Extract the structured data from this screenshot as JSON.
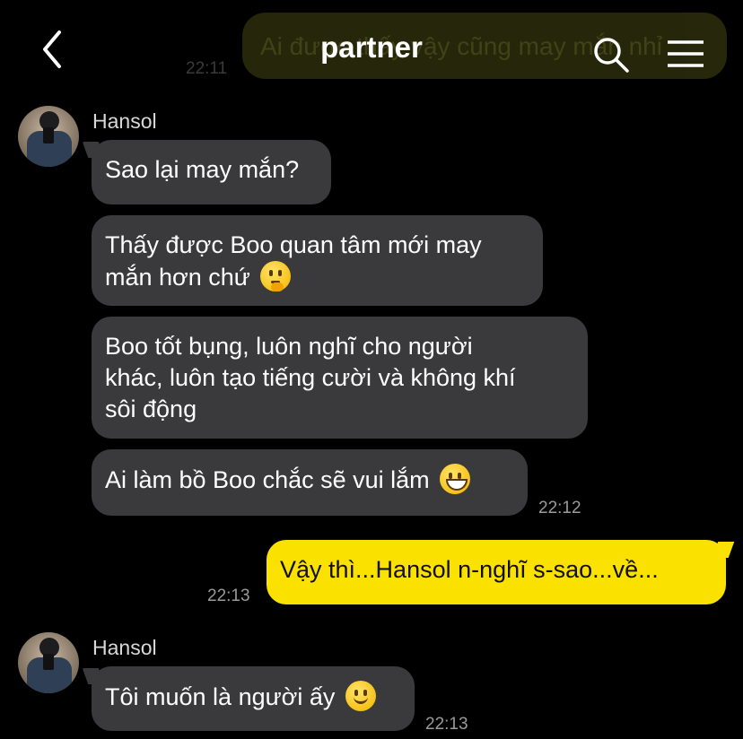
{
  "header": {
    "title": "partner",
    "ghost_message": "Ai được thấy vậy cũng may mắn nhỉ",
    "ghost_time": "22:11",
    "icons": {
      "back": "chevron-left-icon",
      "search": "search-icon",
      "menu": "hamburger-menu-icon"
    }
  },
  "colors": {
    "background": "#000000",
    "incoming_bubble": "#3a3a3c",
    "outgoing_bubble": "#fae100"
  },
  "group1": {
    "sender": "Hansol",
    "messages": [
      "Sao lại may mắn?",
      "Thấy được Boo quan tâm mới may",
      "mắn hơn chứ",
      "Boo tốt bụng, luôn nghĩ cho người",
      "khác, luôn tạo tiếng cười và không khí",
      "sôi động",
      "Ai làm bồ Boo chắc sẽ vui lắm"
    ],
    "time": "22:12"
  },
  "outgoing": {
    "message": "Vậy thì...Hansol n-nghĩ s-sao...về...",
    "time": "22:13"
  },
  "group2": {
    "sender": "Hansol",
    "message": "Tôi muốn là người ấy",
    "time": "22:13"
  }
}
